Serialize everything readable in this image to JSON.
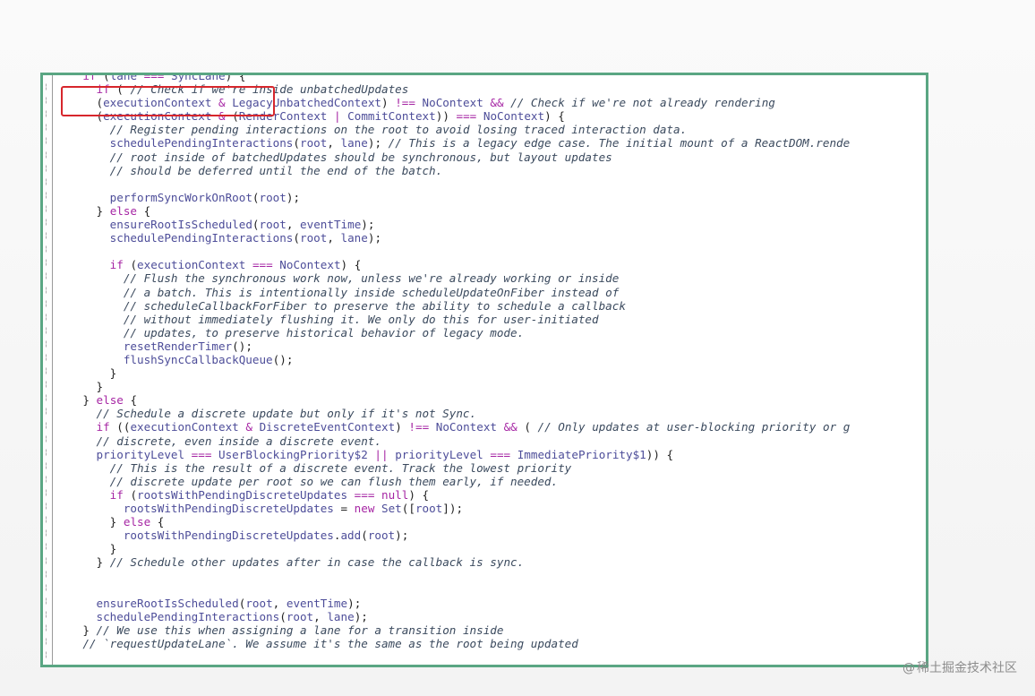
{
  "colors": {
    "frame_border": "#5aa683",
    "highlight_border": "#d7262c",
    "keyword": "#a626a4",
    "identifier": "#4d4d99",
    "comment": "#3b4a5e"
  },
  "code": {
    "lines": [
      "    if (lane === SyncLane) {",
      "      if ( // Check if we're inside unbatchedUpdates",
      "      (executionContext & LegacyUnbatchedContext) !== NoContext && // Check if we're not already rendering",
      "      (executionContext & (RenderContext | CommitContext)) === NoContext) {",
      "        // Register pending interactions on the root to avoid losing traced interaction data.",
      "        schedulePendingInteractions(root, lane); // This is a legacy edge case. The initial mount of a ReactDOM.rende",
      "        // root inside of batchedUpdates should be synchronous, but layout updates",
      "        // should be deferred until the end of the batch.",
      "",
      "        performSyncWorkOnRoot(root);",
      "      } else {",
      "        ensureRootIsScheduled(root, eventTime);",
      "        schedulePendingInteractions(root, lane);",
      "",
      "        if (executionContext === NoContext) {",
      "          // Flush the synchronous work now, unless we're already working or inside",
      "          // a batch. This is intentionally inside scheduleUpdateOnFiber instead of",
      "          // scheduleCallbackForFiber to preserve the ability to schedule a callback",
      "          // without immediately flushing it. We only do this for user-initiated",
      "          // updates, to preserve historical behavior of legacy mode.",
      "          resetRenderTimer();",
      "          flushSyncCallbackQueue();",
      "        }",
      "      }",
      "    } else {",
      "      // Schedule a discrete update but only if it's not Sync.",
      "      if ((executionContext & DiscreteEventContext) !== NoContext && ( // Only updates at user-blocking priority or g",
      "      // discrete, even inside a discrete event.",
      "      priorityLevel === UserBlockingPriority$2 || priorityLevel === ImmediatePriority$1)) {",
      "        // This is the result of a discrete event. Track the lowest priority",
      "        // discrete update per root so we can flush them early, if needed.",
      "        if (rootsWithPendingDiscreteUpdates === null) {",
      "          rootsWithPendingDiscreteUpdates = new Set([root]);",
      "        } else {",
      "          rootsWithPendingDiscreteUpdates.add(root);",
      "        }",
      "      } // Schedule other updates after in case the callback is sync.",
      "",
      "",
      "      ensureRootIsScheduled(root, eventTime);",
      "      schedulePendingInteractions(root, lane);",
      "    } // We use this when assigning a lane for a transition inside",
      "    // `requestUpdateLane`. We assume it's the same as the root being updated"
    ]
  },
  "watermark": {
    "at": "@",
    "text": "稀土掘金技术社区"
  }
}
